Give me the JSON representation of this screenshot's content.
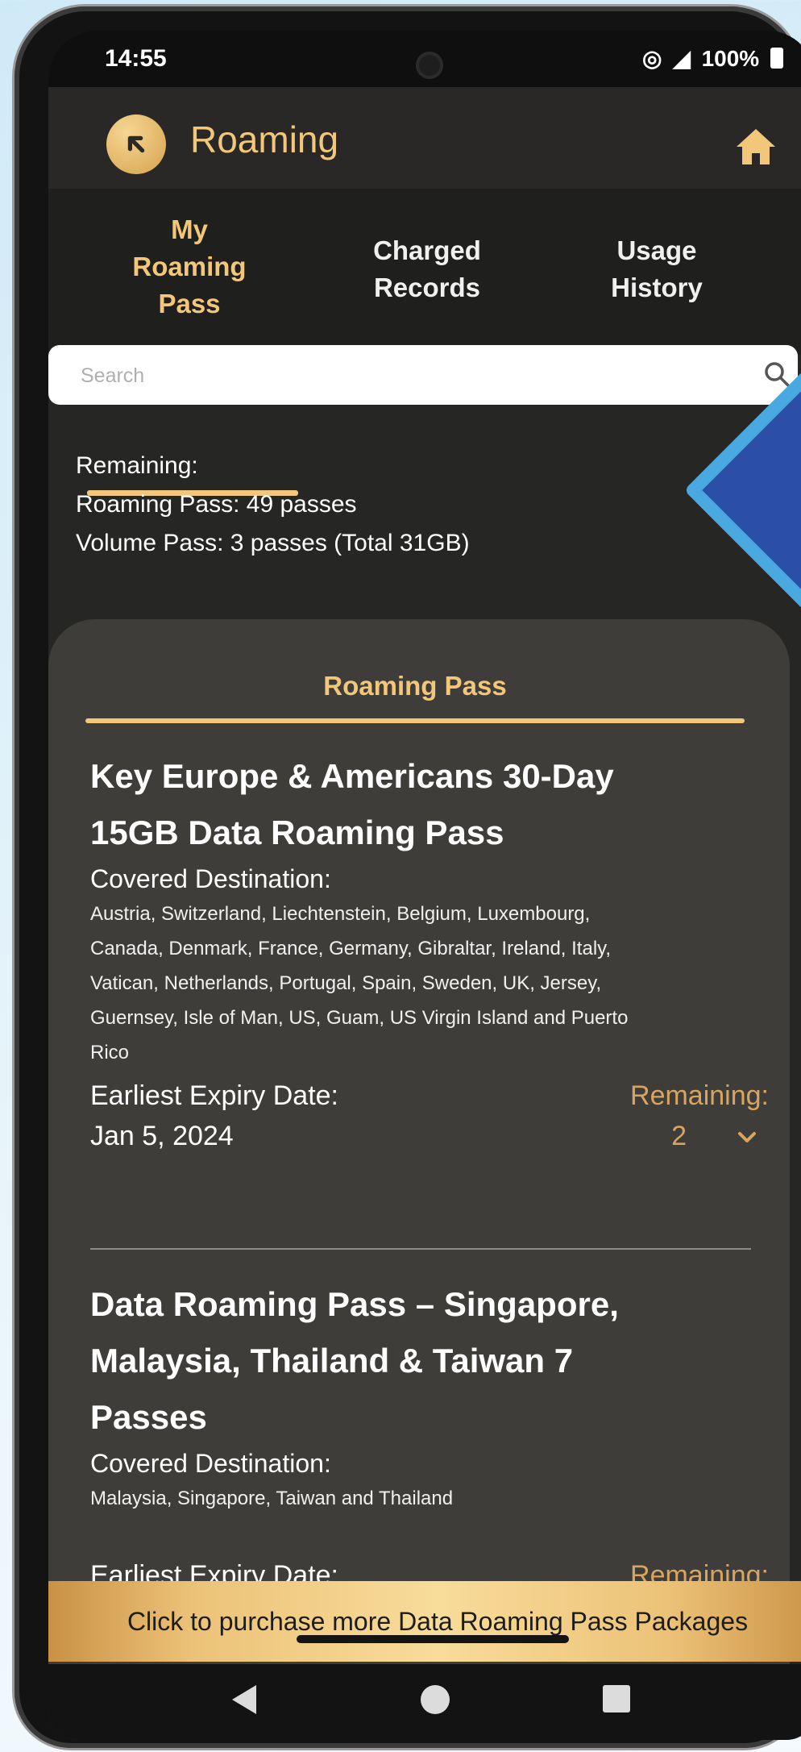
{
  "status_bar": {
    "time": "14:55",
    "battery": "100%"
  },
  "header": {
    "title": "Roaming",
    "back_icon": "arrow-up-left-icon",
    "home_icon": "home-icon",
    "accent_color": "#f3c77a"
  },
  "tabs": [
    {
      "line1": "My",
      "line2": "Roaming",
      "line3": "Pass",
      "active": true
    },
    {
      "line1": "Charged",
      "line2": "Records",
      "active": false
    },
    {
      "line1": "Usage",
      "line2": "History",
      "active": false
    }
  ],
  "search": {
    "placeholder": "Search"
  },
  "summary": {
    "line1": "Remaining:",
    "line2": "Roaming Pass: 49 passes",
    "line3": "Volume Pass: 3 passes (Total 31GB)"
  },
  "card": {
    "title": "Roaming Pass",
    "items": [
      {
        "name_line1": "Key Europe & Americans 30-Day",
        "name_line2": "15GB Data Roaming Pass",
        "covered_label": "Covered Destination:",
        "covered_line1": "Austria, Switzerland, Liechtenstein, Belgium, Luxembourg,",
        "covered_line2": "Canada, Denmark, France, Germany, Gibraltar, Ireland, Italy,",
        "covered_line3": "Vatican, Netherlands, Portugal, Spain, Sweden, UK, Jersey,",
        "covered_line4": "Guernsey, Isle of Man, US, Guam, US Virgin Island and Puerto",
        "covered_line5": "Rico",
        "expiry_label": "Earliest Expiry Date:",
        "expiry_value": "Jan 5, 2024",
        "remaining_label": "Remaining:",
        "remaining_value": "2"
      },
      {
        "name_line1": "Data Roaming Pass – Singapore,",
        "name_line2": "Malaysia, Thailand & Taiwan 7",
        "name_line3": "Passes",
        "covered_label": "Covered Destination:",
        "covered_line1": "Malaysia, Singapore, Taiwan and Thailand",
        "expiry_label": "Earliest Expiry Date:",
        "remaining_label": "Remaining:"
      }
    ]
  },
  "purchase": {
    "label": "Click to purchase more Data Roaming Pass Packages"
  }
}
